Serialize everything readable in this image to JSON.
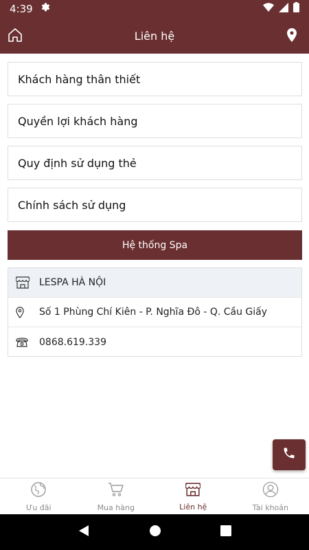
{
  "status_bar": {
    "time": "4:39",
    "icons": [
      "gear-icon",
      "wifi-icon",
      "signal-icon",
      "battery-icon"
    ]
  },
  "header": {
    "title": "Liên hệ",
    "left_icon": "home-icon",
    "right_icon": "location-pin-icon"
  },
  "menu": [
    {
      "label": "Khách hàng thân thiết"
    },
    {
      "label": "Quyền lợi khách hàng"
    },
    {
      "label": "Quy định sử dụng thẻ"
    },
    {
      "label": "Chính sách sử dụng"
    }
  ],
  "spa_button": {
    "label": "Hệ thống Spa"
  },
  "spa_card": {
    "name": "LESPA HÀ NỘI",
    "address": "Số 1 Phùng Chí Kiên - P. Nghĩa Đô - Q. Cầu Giấy",
    "phone": "0868.619.339"
  },
  "fab": {
    "icon": "phone-icon"
  },
  "tabs": [
    {
      "label": "Ưu đãi",
      "icon": "globe-icon",
      "active": false
    },
    {
      "label": "Mua hàng",
      "icon": "cart-icon",
      "active": false
    },
    {
      "label": "Liên hệ",
      "icon": "store-icon",
      "active": true
    },
    {
      "label": "Tài khoản",
      "icon": "user-icon",
      "active": false
    }
  ],
  "colors": {
    "primary": "#6a2f30",
    "card_head": "#eef1f6",
    "inactive": "#8a8a8a"
  },
  "system_nav": [
    "back-icon",
    "home-circle-icon",
    "recents-icon"
  ]
}
